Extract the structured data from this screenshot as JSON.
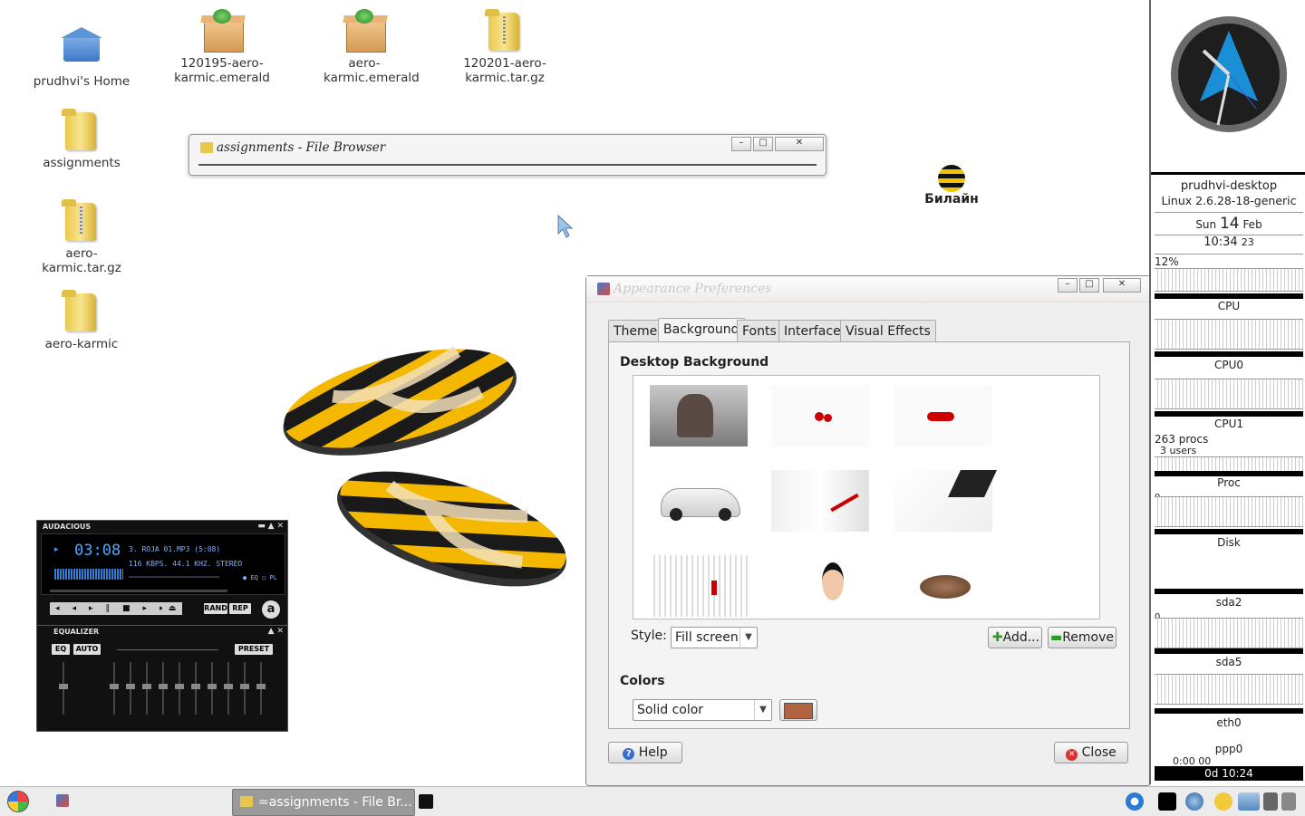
{
  "desktop": {
    "icons": [
      {
        "label": "prudhvi's Home",
        "icon": "home-icon"
      },
      {
        "label": "assignments",
        "icon": "folder-icon"
      },
      {
        "label": "aero-karmic.tar.gz",
        "icon": "zip-folder-icon"
      },
      {
        "label": "aero-karmic",
        "icon": "folder-icon"
      },
      {
        "label": "120195-aero-karmic.emerald",
        "icon": "package-icon"
      },
      {
        "label": "aero-karmic.emerald",
        "icon": "package-icon"
      },
      {
        "label": "120201-aero-karmic.tar.gz",
        "icon": "zip-folder-icon"
      }
    ],
    "brand_text": "Билайн"
  },
  "file_browser": {
    "title": "assignments - File Browser"
  },
  "appearance": {
    "title": "Appearance Preferences",
    "tabs": [
      "Theme",
      "Background",
      "Fonts",
      "Interface",
      "Visual Effects"
    ],
    "active_tab": "Background",
    "section_title": "Desktop Background",
    "style_label": "Style:",
    "style_value": "Fill screen",
    "add_label": "Add...",
    "remove_label": "Remove",
    "colors_label": "Colors",
    "color_mode": "Solid color",
    "color_swatch": "#b0633e",
    "help_label": "Help",
    "close_label": "Close"
  },
  "audacious": {
    "title": "AUDACIOUS",
    "time": "03:08",
    "track": "3. ROJA 01.MP3 (5:08)",
    "info": "116 KBPS. 44.1 KHZ. STEREO",
    "eq_label": "EQ",
    "pl_label": "PL",
    "rand_label": "RAND",
    "rep_label": "REP",
    "equalizer_title": "EQUALIZER",
    "eq_btn": "EQ",
    "auto_btn": "AUTO",
    "preset_btn": "PRESET"
  },
  "conky": {
    "hostname": "prudhvi-desktop",
    "kernel": "Linux 2.6.28-18-generic",
    "date_day": "Sun",
    "date_num": "14",
    "date_month": "Feb",
    "time": "10:34",
    "seconds": "23",
    "cpu_percent": "12%",
    "labels": {
      "cpu": "CPU",
      "cpu0": "CPU0",
      "cpu1": "CPU1",
      "proc": "Proc",
      "disk": "Disk",
      "sda2": "sda2",
      "sda5": "sda5",
      "eth0": "eth0",
      "ppp0": "ppp0"
    },
    "procs": "263 procs",
    "users": "3 users",
    "zero_a": "0",
    "zero_b": "0",
    "ppp_time": "0:00",
    "ppp_sub": "00",
    "uptime": "0d 10:24"
  },
  "taskbar": {
    "task_label": "=assignments - File Br..."
  }
}
